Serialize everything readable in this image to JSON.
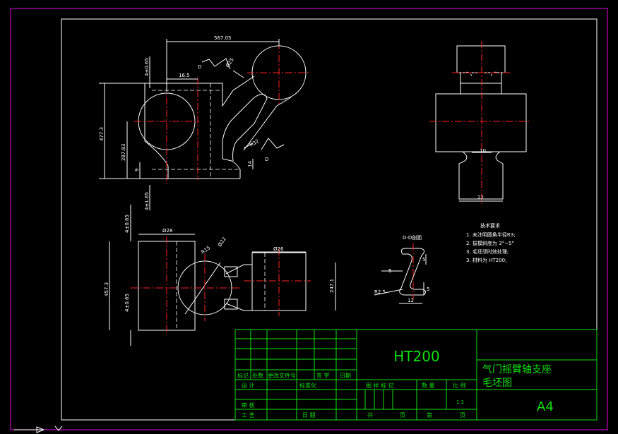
{
  "dimensions": {
    "top_overall": "567.05",
    "d_label_1": "D",
    "d_label_2": "D",
    "left_tol_top": "4±0.65",
    "offset_16": "16.5",
    "diam_r25": "Ø25",
    "height_477": "477.3",
    "height_287": "287.83",
    "small_9": "9",
    "r32": "R32",
    "small_14": "14",
    "left_tol_bottom": "4±1.65",
    "right_10": "10",
    "right_22": "22",
    "tol_0_65_top": "4±0.65",
    "tol_0_65_bot": "4±0.65",
    "phi28": "Ø28",
    "r15": "R15",
    "phi22": "Ø22",
    "phi26": "Ø26",
    "h_4573": "457.3",
    "h_2471": "247.1",
    "section_title": "D-D剖面",
    "sec_5a": "5",
    "sec_5b": "5",
    "sec_5c": "5",
    "sec_r25": "R2.5",
    "sec_12": "12"
  },
  "notes": {
    "title": "技术要求",
    "lines": [
      "1. 未注明圆角半径R3;",
      "2. 拔模斜度为 3°~5°",
      "3. 毛坯须时效处理;",
      "3. 材料为 HT200;"
    ]
  },
  "title_block": {
    "material": "HT200",
    "part_name": "气门摇臂轴支座",
    "drawing_type": "毛坯图",
    "sheet_size": "A4",
    "scale": "1:1",
    "row_labels": [
      "标记",
      "处数",
      "更改文件号",
      "签 字",
      "日期"
    ],
    "design": "设 计",
    "standardize": "标准化",
    "review": "审 核",
    "process": "工 艺",
    "date": "日 期",
    "stage_mark": "图 样 标 记",
    "quantity": "数 量",
    "ratio": "比 例",
    "total": "共",
    "page1": "页",
    "sheet": "第",
    "page2": "页"
  }
}
